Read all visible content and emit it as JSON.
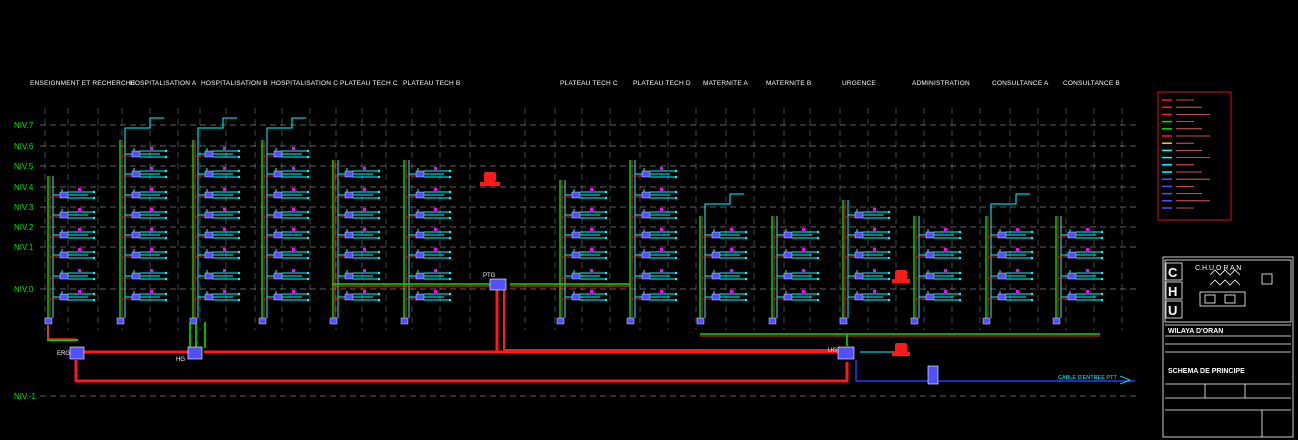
{
  "buildings": [
    "ENSEIGNMENT ET RECHERCHE",
    "HOSPITALISATION A",
    "HOSPITALISATION B",
    "HOSPITALISATION C",
    "PLATEAU TECH C",
    "PLATEAU TECH B",
    "PLATEAU TECH C",
    "PLATEAU TECH D",
    "MATERNITE A",
    "MATERNITE B",
    "URGENCE",
    "ADMINISTRATION",
    "CONSULTANCE A",
    "CONSULTANCE B"
  ],
  "levels": [
    "NIV.7",
    "NIV.6",
    "NIV.5",
    "NIV.4",
    "NIV.3",
    "NIV.2",
    "NIV.1",
    "NIV.0",
    "NIV.-1"
  ],
  "nodes": {
    "erg": "ERG",
    "hg": "HG",
    "ptg": "PTG",
    "ug": "UG"
  },
  "cable_label": "CABLE D'ENTREE PTT",
  "title_block": {
    "org": "C.H.U  O R A N",
    "logo_letters": [
      "C",
      "H",
      "U"
    ],
    "wilaya": "WILAYA D'ORAN",
    "schema": "SCHEMA DE PRINCIPE"
  },
  "colors": {
    "background": "#000000",
    "trunk": "#ff1a1a",
    "ground": "#00e000",
    "riser": "#00ffff",
    "cable": "#1e3cff",
    "node": "#5050ff",
    "text": "#ffffff"
  }
}
